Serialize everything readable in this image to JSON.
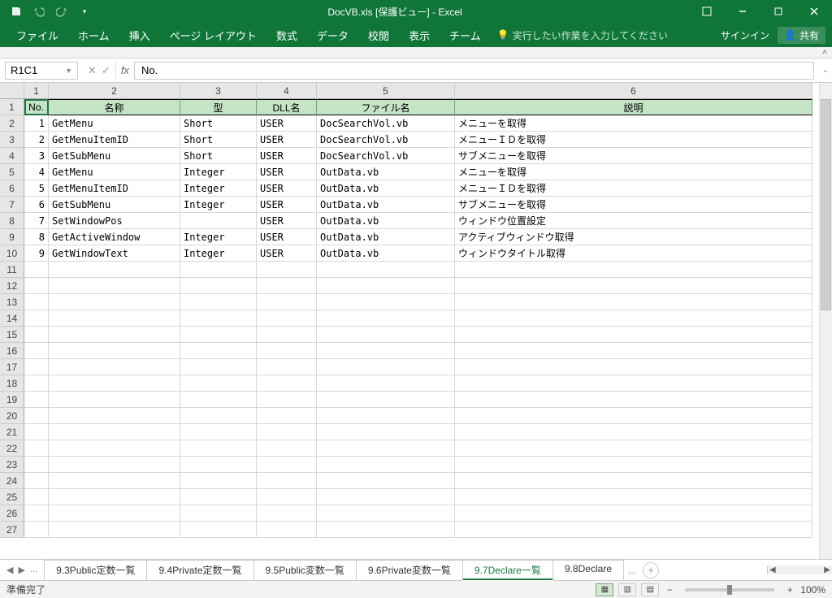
{
  "titlebar": {
    "title": "DocVB.xls  [保護ビュー] - Excel"
  },
  "ribbon": {
    "tabs": [
      "ファイル",
      "ホーム",
      "挿入",
      "ページ レイアウト",
      "数式",
      "データ",
      "校閲",
      "表示",
      "チーム"
    ],
    "tellme": "実行したい作業を入力してください",
    "signin": "サインイン",
    "share": "共有"
  },
  "formula": {
    "namebox": "R1C1",
    "value": "No."
  },
  "columns": {
    "labels": [
      "1",
      "2",
      "3",
      "4",
      "5",
      "6"
    ]
  },
  "headers": [
    "No.",
    "名称",
    "型",
    "DLL名",
    "ファイル名",
    "説明"
  ],
  "rows_visible": 27,
  "data": [
    {
      "no": "1",
      "name": "GetMenu",
      "type": "Short",
      "dll": "USER",
      "file": "DocSearchVol.vb",
      "desc": "メニューを取得"
    },
    {
      "no": "2",
      "name": "GetMenuItemID",
      "type": "Short",
      "dll": "USER",
      "file": "DocSearchVol.vb",
      "desc": "メニューＩＤを取得"
    },
    {
      "no": "3",
      "name": "GetSubMenu",
      "type": "Short",
      "dll": "USER",
      "file": "DocSearchVol.vb",
      "desc": "サブメニューを取得"
    },
    {
      "no": "4",
      "name": "GetMenu",
      "type": "Integer",
      "dll": "USER",
      "file": "OutData.vb",
      "desc": "メニューを取得"
    },
    {
      "no": "5",
      "name": "GetMenuItemID",
      "type": "Integer",
      "dll": "USER",
      "file": "OutData.vb",
      "desc": "メニューＩＤを取得"
    },
    {
      "no": "6",
      "name": "GetSubMenu",
      "type": "Integer",
      "dll": "USER",
      "file": "OutData.vb",
      "desc": "サブメニューを取得"
    },
    {
      "no": "7",
      "name": "SetWindowPos",
      "type": "",
      "dll": "USER",
      "file": "OutData.vb",
      "desc": "ウィンドウ位置設定"
    },
    {
      "no": "8",
      "name": "GetActiveWindow",
      "type": "Integer",
      "dll": "USER",
      "file": "OutData.vb",
      "desc": "アクティブウィンドウ取得"
    },
    {
      "no": "9",
      "name": "GetWindowText",
      "type": "Integer",
      "dll": "USER",
      "file": "OutData.vb",
      "desc": "ウィンドウタイトル取得"
    }
  ],
  "sheets": {
    "tabs": [
      "9.3Public定数一覧",
      "9.4Private定数一覧",
      "9.5Public変数一覧",
      "9.6Private変数一覧",
      "9.7Declare一覧",
      "9.8Declare"
    ],
    "active": "9.7Declare一覧",
    "overflow": "..."
  },
  "status": {
    "left": "準備完了",
    "zoom": "100%"
  }
}
